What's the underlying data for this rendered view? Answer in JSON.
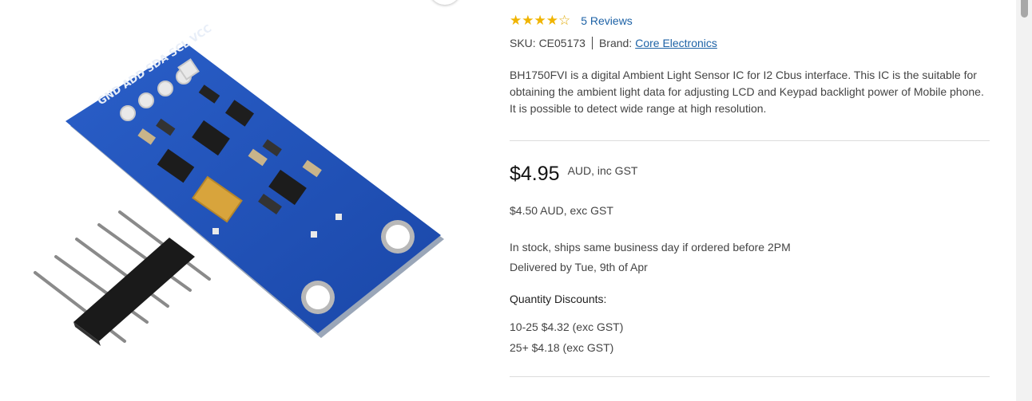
{
  "product": {
    "image_alt": "BH1750FVI light sensor module with header pins",
    "pin_labels": "GND ADD SDA SCL VCC",
    "rating": {
      "stars": "★★★★",
      "half": "☆",
      "reviews": "5 Reviews"
    },
    "sku_label": "SKU: CE05173",
    "brand_label": "Brand:",
    "brand_name": "Core Electronics",
    "description": "BH1750FVI is a digital Ambient Light Sensor IC for I2 Cbus interface. This IC is the suitable for obtaining the ambient light data for adjusting LCD and Keypad backlight power of Mobile phone. It is possible to detect wide range at high resolution.",
    "price": "$4.95",
    "price_suffix": "AUD, inc GST",
    "price_ex": "$4.50 AUD, exc GST",
    "stock_line": "In stock, ships same business day if ordered before 2PM",
    "delivery_line": "Delivered by Tue, 9th of Apr",
    "quantity_discounts_title": "Quantity Discounts:",
    "quantity_discounts": [
      "10-25 $4.32 (exc GST)",
      "25+ $4.18 (exc GST)"
    ]
  },
  "colors": {
    "accent_star": "#f0b400",
    "link": "#1d62a6",
    "pcb": "#1f50b8",
    "divider": "#dcdcdc"
  }
}
